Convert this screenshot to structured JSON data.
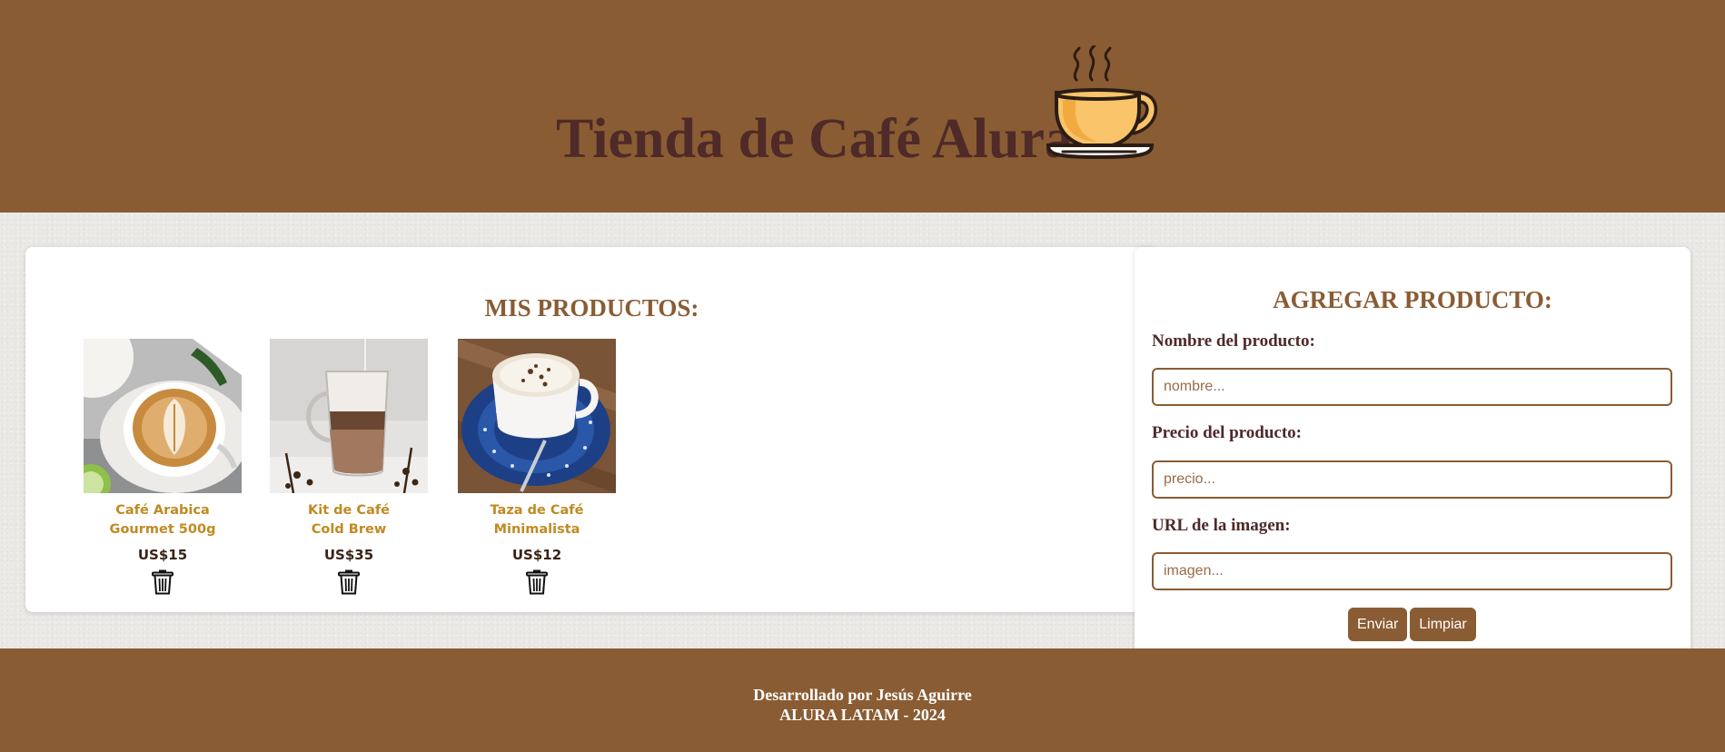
{
  "header": {
    "title": "Tienda de Café Alura",
    "logo_icon": "coffee-cup-icon",
    "background": "#8a5c33",
    "title_color": "#4e2a28"
  },
  "products": {
    "heading": "MIS PRODUCTOS:",
    "items": [
      {
        "name_line1": "Café Arabica",
        "name_line2": "Gourmet 500g",
        "price": "US$15",
        "image": "latte-art-cup-photo",
        "delete_icon": "trash-icon"
      },
      {
        "name_line1": "Kit de Café",
        "name_line2": "Cold Brew",
        "price": "US$35",
        "image": "cold-brew-glass-photo",
        "delete_icon": "trash-icon"
      },
      {
        "name_line1": "Taza de Café",
        "name_line2": "Minimalista",
        "price": "US$12",
        "image": "blue-saucer-cup-photo",
        "delete_icon": "trash-icon"
      }
    ],
    "name_color": "#c08a21"
  },
  "form": {
    "heading": "AGREGAR PRODUCTO:",
    "name_label": "Nombre del producto:",
    "name_placeholder": "nombre...",
    "name_value": "",
    "price_label": "Precio del producto:",
    "price_placeholder": "precio...",
    "price_value": "",
    "image_label": "URL de la imagen:",
    "image_placeholder": "imagen...",
    "image_value": "",
    "submit_label": "Enviar",
    "clear_label": "Limpiar"
  },
  "footer": {
    "line1": "Desarrollado por Jesús Aguirre",
    "line2": "ALURA LATAM - 2024"
  }
}
